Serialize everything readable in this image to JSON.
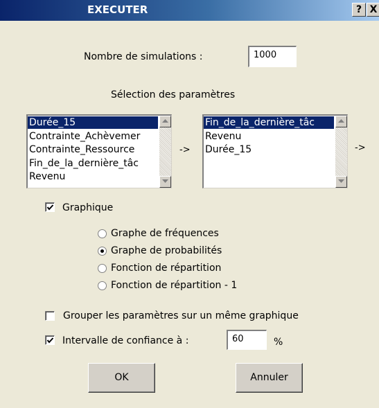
{
  "window": {
    "title": "EXECUTER",
    "help_label": "?",
    "close_label": "X"
  },
  "simulations": {
    "label": "Nombre de simulations :",
    "value": "1000"
  },
  "parameters": {
    "heading": "Sélection des paramètres",
    "available": [
      {
        "label": "Durée_15",
        "selected": true
      },
      {
        "label": "Contrainte_Achèvemer",
        "selected": false
      },
      {
        "label": "Contrainte_Ressource",
        "selected": false
      },
      {
        "label": "Fin_de_la_dernière_tâc",
        "selected": false
      },
      {
        "label": "Revenu",
        "selected": false
      }
    ],
    "chosen": [
      {
        "label": "Fin_de_la_dernière_tâc",
        "selected": true
      },
      {
        "label": "Revenu",
        "selected": false
      },
      {
        "label": "Durée_15",
        "selected": false
      }
    ],
    "arrow_1": "->",
    "arrow_2": "->"
  },
  "graph": {
    "checkbox_label": "Graphique",
    "checked": true,
    "options": [
      {
        "label": "Graphe de fréquences",
        "selected": false
      },
      {
        "label": "Graphe de probabilités",
        "selected": true
      },
      {
        "label": "Fonction de répartition",
        "selected": false
      },
      {
        "label": "Fonction de répartition - 1",
        "selected": false
      }
    ]
  },
  "group": {
    "label": "Grouper les paramètres sur un même graphique",
    "checked": false
  },
  "confidence": {
    "label": "Intervalle de confiance à :",
    "checked": true,
    "value": "60",
    "unit": "%"
  },
  "buttons": {
    "ok": "OK",
    "cancel": "Annuler"
  },
  "colors": {
    "selection": "#0a246a",
    "dialog_bg": "#ece9d8"
  }
}
